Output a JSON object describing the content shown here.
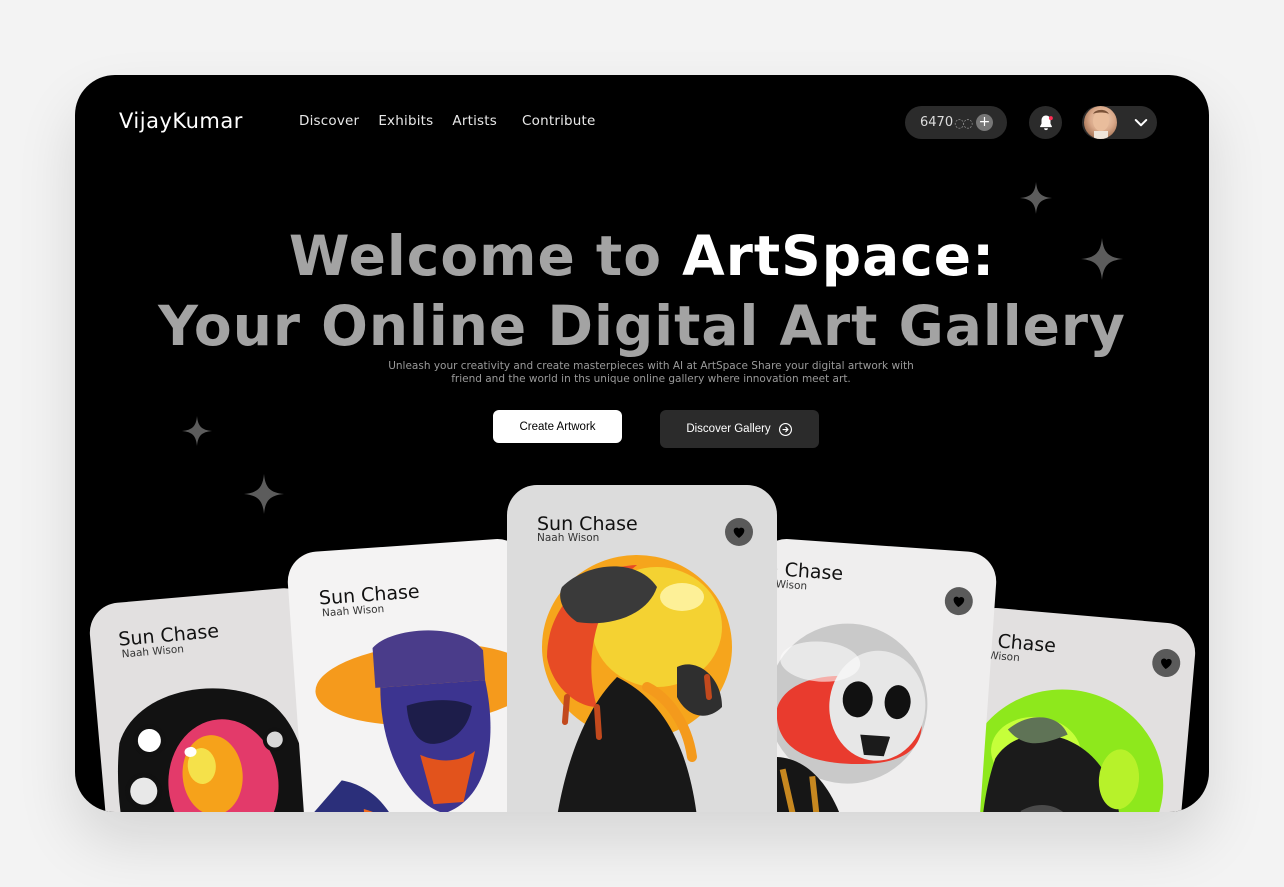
{
  "brand": {
    "logo": "VijayKumar"
  },
  "nav": {
    "items": [
      "Discover",
      "Exhibits",
      "Artists",
      "Contribute"
    ]
  },
  "header": {
    "credits_value": "6470",
    "credits_suffix": "◌◌",
    "add_credits_icon": "plus-icon",
    "notifications_icon": "bell-icon",
    "profile_menu_icon": "chevron-down-icon"
  },
  "hero": {
    "title_part1": "Welcome to ",
    "title_highlight": "ArtSpace:",
    "title_line2": "Your Online Digital Art Gallery",
    "subtitle_line1": "Unleash  your creativity and create masterpieces with AI at ArtSpace Share your digital artwork with",
    "subtitle_line2": "friend and the world in ths unique online gallery where innovation meet art.",
    "primary_button": "Create Artwork",
    "secondary_button": "Discover Gallery"
  },
  "cards": [
    {
      "title": "Sun Chase",
      "author": "Naah Wison"
    },
    {
      "title": "Sun Chase",
      "author": "Naah Wison"
    },
    {
      "title": "Sun Chase",
      "author": "Naah Wison"
    },
    {
      "title": "n Chase",
      "author": "n Wison"
    },
    {
      "title": "n Chase",
      "author": "n Wison"
    }
  ],
  "colors": {
    "background": "#000000",
    "page": "#f3f3f3",
    "muted_text": "#a3a3a3",
    "pill": "#2b2b2b",
    "card": "#efefef"
  }
}
